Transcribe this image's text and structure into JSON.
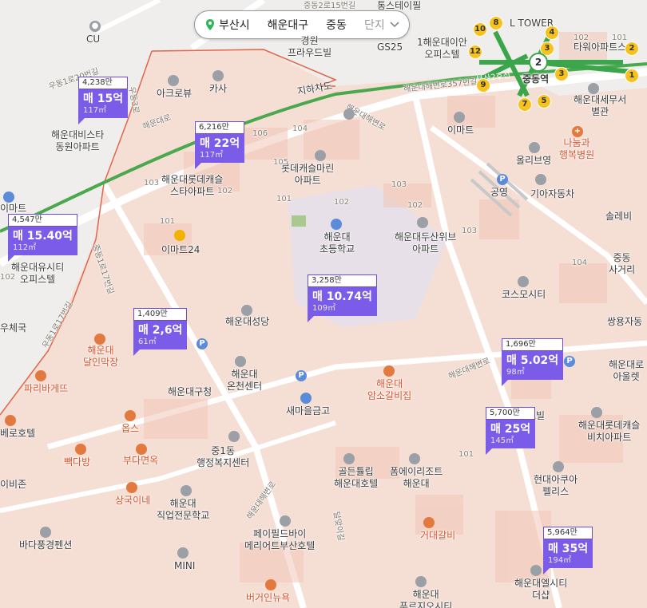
{
  "breadcrumb": {
    "city": "부산시",
    "district": "해운대구",
    "dong": "중동",
    "complex": "단지"
  },
  "listings": [
    {
      "id": "l1",
      "top": "4,238만",
      "price": "매 15억",
      "area": "117㎡"
    },
    {
      "id": "l2",
      "top": "6,216만",
      "price": "매 22억",
      "area": "117㎡"
    },
    {
      "id": "l3",
      "top": "4,547만",
      "price": "매 15.40억",
      "area": "112㎡"
    },
    {
      "id": "l4",
      "top": "3,258만",
      "price": "매 10.74억",
      "area": "109㎡"
    },
    {
      "id": "l5",
      "top": "1,409만",
      "price": "매 2,6억",
      "area": "61㎡"
    },
    {
      "id": "l6",
      "top": "1,696만",
      "price": "매 5.02억",
      "area": "98㎡"
    },
    {
      "id": "l7",
      "top": "5,700만",
      "price": "매 25억",
      "area": "145㎡"
    },
    {
      "id": "l8",
      "top": "5,964만",
      "price": "매 35억",
      "area": "194㎡"
    }
  ],
  "places": {
    "cu": "CU",
    "gyeongwon": "경원\n프라우드빌",
    "gs25": "GS25",
    "tongsutel": "통스테이필",
    "haeundaeoffice": "1해운대이안\n오피스텔",
    "ltower": "L TOWER",
    "towerapart": "타워아파트스",
    "junggu_station": "중동역",
    "taxoffice": "해운대세무서\n별관",
    "nanum": "나눔과\n행복병원",
    "olliveyoung": "올리브영",
    "emart": "이마트",
    "park1": "공영",
    "kia": "기아자동차",
    "solleb": "솔레비",
    "jungdong_cross": "중동\n사거리",
    "akrobi": "아크로뷰",
    "kasa": "카사",
    "jihachado": "지하차도",
    "haeundae_vista": "해운대비스타\n동원아파트",
    "lotte_castle_star": "해운대롯데캐슬\n스타아파트",
    "lotte_castle_marine": "롯데캐슬마린\n아파트",
    "haeundae_school": "해운대\n초등학교",
    "doosan_weve": "해운대두산위브\n아파트",
    "emart24": "이마트24",
    "university_city": "해운대유시티\n오피스텔",
    "emart_left": "이마트",
    "post": "우체국",
    "cosmos_city": "코스모시티",
    "ssangyong": "쌍용자동",
    "haeundae_seongdang": "해운대성당",
    "dalin_makjang": "해운대\n달인막장",
    "paris": "파리바게뜨",
    "gucheong": "해운대구청",
    "oncheon": "해운대\n온천센터",
    "saemaeul": "새마을금고",
    "amso_galbi": "해운대\n암소갈비집",
    "best_hotel": "베로호텔",
    "obs": "옵스",
    "baekdabang": "빽다방",
    "budaemyun": "부다면옥",
    "jungdong_admin": "중1동\n행정복지센터",
    "golden_tulip": "골든튤립\n해운대호텔",
    "pamelia": "폼에이리조트\n해운대",
    "hyundai_aqua": "현대아쿠아\n펠리스",
    "lotte_beach": "해운대롯데캐슬\n비치아파트",
    "sangguk": "상국이네",
    "vocational": "해운대\n직업전문학교",
    "payfield": "페이필드바이\n메리어트부산호텔",
    "geodae": "거대갈비",
    "bada_pension": "바다풍경펜션",
    "mini": "MINI",
    "burger": "버거인뉴욕",
    "heritage": "해운대엘시티\n더샵",
    "fresh": "해운대\n푸르지오시티",
    "haeundae_roa": "해운대로\n아울렛",
    "ibizon": "이비존",
    "ijimat": "이마트",
    "nbabel": "르빌"
  },
  "roads": {
    "udong1": "우동1로20번길",
    "udong3": "우동3로",
    "haeundaero": "해운대로",
    "haeundaero357": "해운대해변로357번길",
    "jungdong2": "중동2로",
    "haeundaebeach": "해운대해변로",
    "udong1ro17": "우동1로17번길",
    "jungdong1": "중동1로17번길",
    "dalmaji": "달맞이길",
    "metro_line": "부산2호선",
    "haeundaebeach2": "해운대해변로",
    "jungdong2b": "중동2로15번길"
  },
  "block_numbers": [
    "104",
    "106",
    "105",
    "103",
    "101",
    "102",
    "101",
    "102",
    "103",
    "102",
    "104",
    "102",
    "103",
    "101",
    "101",
    "102"
  ],
  "colors": {
    "listing": "#7b5ce8",
    "metro_line": "#3aa54a",
    "boundary": "#e0654a",
    "station": "#f6c21b"
  }
}
